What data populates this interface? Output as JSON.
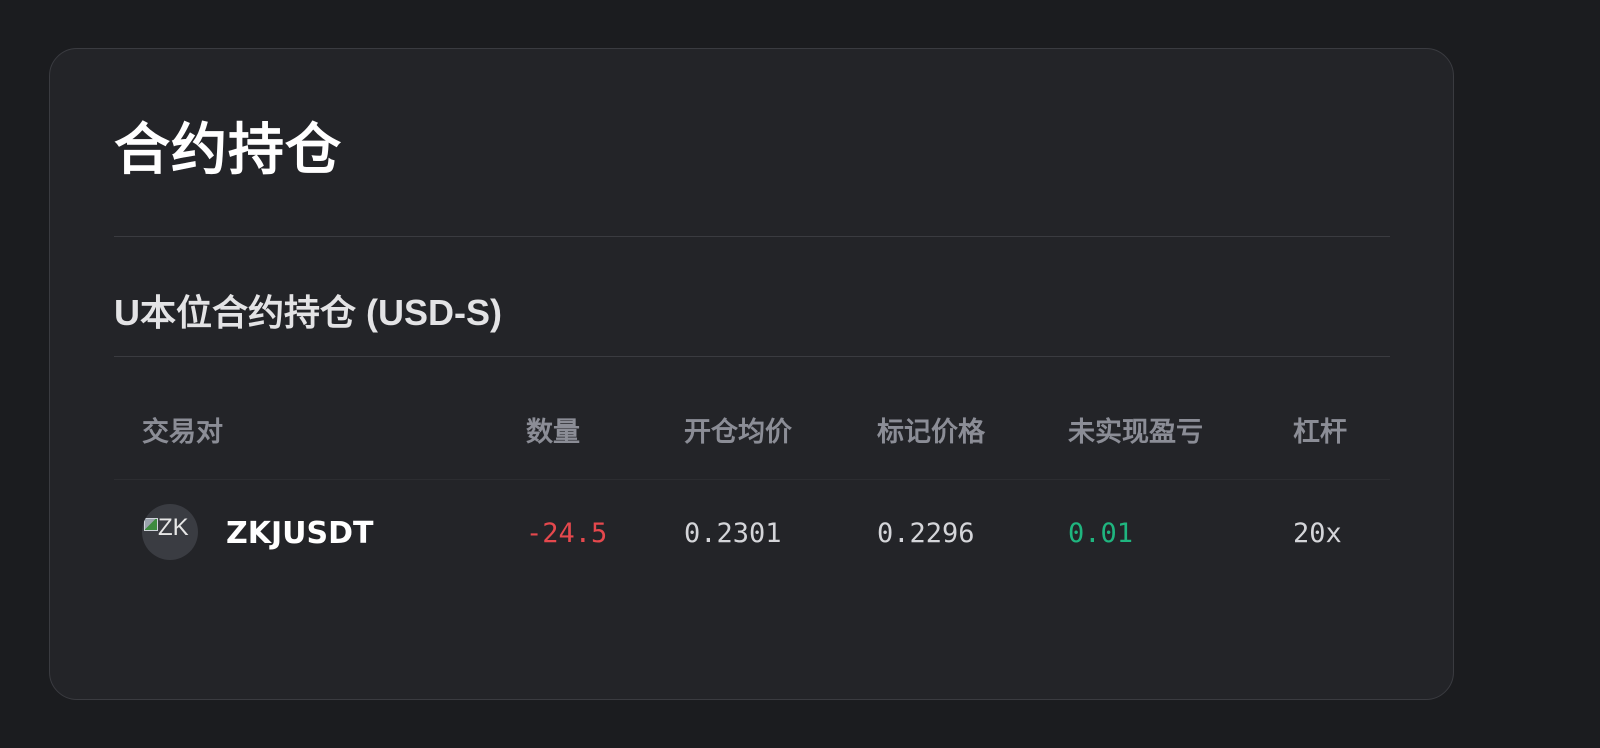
{
  "page": {
    "title": "合约持仓"
  },
  "section": {
    "title": "U本位合约持仓 (USD-S)"
  },
  "table": {
    "columns": [
      "交易对",
      "数量",
      "开仓均价",
      "标记价格",
      "未实现盈亏",
      "杠杆"
    ],
    "rows": [
      {
        "avatar_alt": "ZK",
        "pair": "ZKJUSDT",
        "quantity": "-24.5",
        "entry_price": "0.2301",
        "mark_price": "0.2296",
        "unrealized_pnl": "0.01",
        "leverage": "20x"
      }
    ]
  },
  "colors": {
    "negative": "#e5484d",
    "positive": "#1fb57f",
    "background": "#1b1c1f",
    "card": "#232428"
  },
  "icons": {
    "avatar": "broken-image-icon"
  }
}
